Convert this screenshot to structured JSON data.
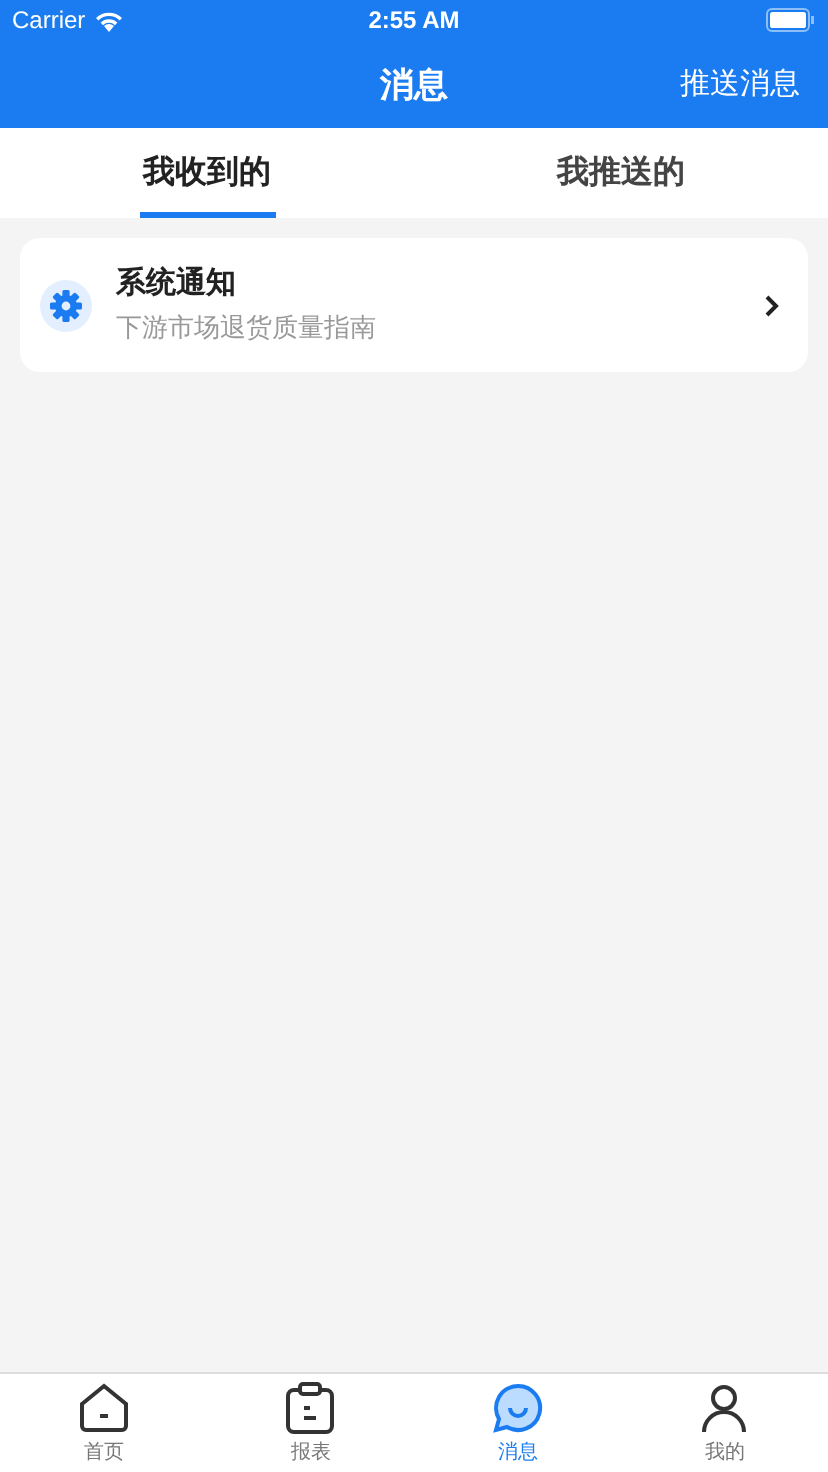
{
  "status_bar": {
    "carrier": "Carrier",
    "time": "2:55 AM"
  },
  "nav_bar": {
    "title": "消息",
    "action": "推送消息"
  },
  "tabs": [
    {
      "label": "我收到的",
      "selected": true
    },
    {
      "label": "我推送的",
      "selected": false
    }
  ],
  "messages": [
    {
      "title": "系统通知",
      "summary": "下游市场退货质量指南"
    }
  ],
  "tab_bar": [
    {
      "label": "首页",
      "kind": "home",
      "selected": false
    },
    {
      "label": "报表",
      "kind": "report",
      "selected": false
    },
    {
      "label": "消息",
      "kind": "message",
      "selected": true
    },
    {
      "label": "我的",
      "kind": "profile",
      "selected": false
    }
  ]
}
